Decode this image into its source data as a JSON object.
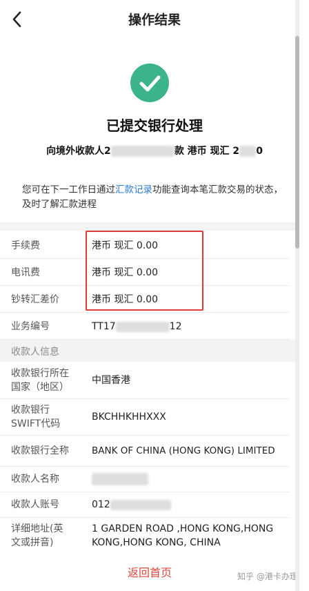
{
  "nav": {
    "title": "操作结果",
    "back_icon": "chevron-left-icon"
  },
  "result": {
    "icon": "check-circle-icon",
    "title": "已提交银行处理",
    "summary_prefix": "向境外收款人2",
    "summary_middle": "款 港币 现汇 2",
    "summary_suffix": "0"
  },
  "notice": {
    "before": "您可在下一工作日通过",
    "link": "汇款记录",
    "after": "功能查询本笔汇款交易的状态，及时了解汇款进程"
  },
  "fees": [
    {
      "label": "手续费",
      "value": "港币 现汇 0.00"
    },
    {
      "label": "电讯费",
      "value": "港币 现汇 0.00"
    },
    {
      "label": "钞转汇差价",
      "value": "港币 现汇 0.00"
    }
  ],
  "business_no": {
    "label": "业务编号",
    "prefix": "TT17",
    "suffix": "12"
  },
  "section_title": "收款人信息",
  "payee": {
    "bank_country": {
      "label_line1": "收款银行所在",
      "label_line2": "国家（地区）",
      "value": "中国香港"
    },
    "swift": {
      "label_line1": "收款银行",
      "label_line2": "SWIFT代码",
      "value": "BKCHHKHHXXX"
    },
    "bank_name": {
      "label": "收款银行全称",
      "value": "BANK OF CHINA (HONG KONG) LIMITED"
    },
    "name": {
      "label": "收款人名称"
    },
    "account": {
      "label": "收款人账号",
      "prefix": "012"
    },
    "address": {
      "label_line1": "详细地址(英",
      "label_line2": "文或拼音)",
      "value_line1": "1 GARDEN ROAD ,HONG KONG,HONG",
      "value_line2": "KONG,HONG KONG, CHINA"
    }
  },
  "footer": {
    "home_link": "返回首页",
    "watermark": "知乎 @港卡办理"
  },
  "colors": {
    "success": "#3cb489",
    "link": "#2b7cd3",
    "highlight_box": "#e23a3a",
    "footer_link": "#e0483f"
  }
}
